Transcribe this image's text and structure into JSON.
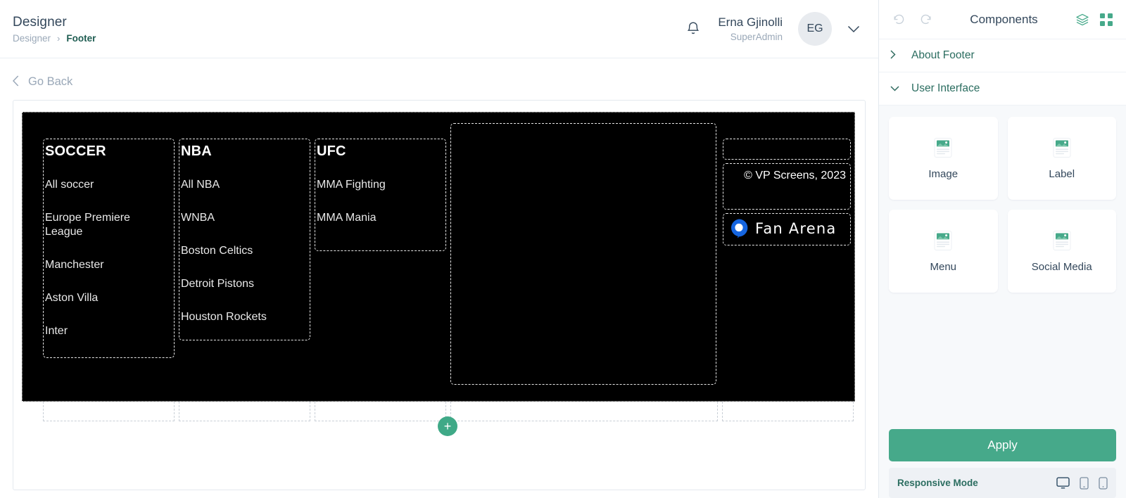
{
  "header": {
    "title": "Designer",
    "breadcrumb": {
      "root": "Designer",
      "separator": "›",
      "current": "Footer"
    },
    "bell_icon": "notification-bell-icon",
    "user": {
      "name": "Erna Gjinolli",
      "role": "SuperAdmin",
      "initials": "EG",
      "chevron": "⌄"
    }
  },
  "toolbar": {
    "go_back": "Go Back",
    "back_chevron": "‹"
  },
  "canvas": {
    "add_button_label": "+",
    "columns": [
      {
        "title": "SOCCER",
        "links": [
          "All soccer",
          "Europe Premiere League",
          "Manchester",
          "Aston Villa",
          "Inter"
        ]
      },
      {
        "title": "NBA",
        "links": [
          "All NBA",
          "WNBA",
          "Boston Celtics",
          "Detroit Pistons",
          "Houston Rockets"
        ]
      },
      {
        "title": "UFC",
        "links": [
          "MMA Fighting",
          "MMA Mania"
        ]
      }
    ],
    "copyright": "© VP Screens, 2023",
    "brand": {
      "name": "Fan Arena",
      "mark_color": "#1565e0"
    },
    "background_color": "#000000"
  },
  "panel": {
    "title": "Components",
    "undo_icon": "undo-icon",
    "redo_icon": "redo-icon",
    "layers_icon": "layers-icon",
    "grid_icon": "grid-icon",
    "sections": [
      {
        "label": "About Footer",
        "expanded": false,
        "chevron": "›"
      },
      {
        "label": "User Interface",
        "expanded": true,
        "chevron": "⌄"
      }
    ],
    "components": [
      {
        "label": "Image",
        "icon": "image-placeholder-icon"
      },
      {
        "label": "Label",
        "icon": "image-placeholder-icon"
      },
      {
        "label": "Menu",
        "icon": "image-placeholder-icon"
      },
      {
        "label": "Social Media",
        "icon": "image-placeholder-icon"
      }
    ],
    "apply_label": "Apply",
    "responsive": {
      "label": "Responsive Mode",
      "modes": [
        "desktop-icon",
        "tablet-icon",
        "mobile-icon"
      ]
    },
    "accent_color": "#46a98a",
    "text_color": "#2b6d60"
  }
}
